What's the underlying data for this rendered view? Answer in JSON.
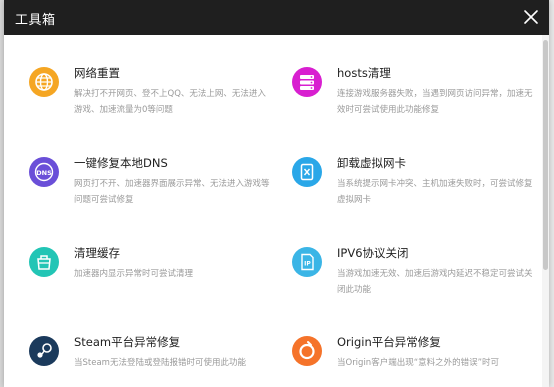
{
  "window": {
    "title": "工具箱"
  },
  "tools": [
    {
      "icon": "globe-icon",
      "color": "#f5a623",
      "name": "网络重置",
      "desc": "解决打不开网页、登不上QQ、无法上网、无法进入游戏、加速流量为0等问题"
    },
    {
      "icon": "server-icon",
      "color": "#d81fd0",
      "name": "hosts清理",
      "desc": "连接游戏服务器失败，当遇到网页访问异常，加速无效时可尝试使用此功能修复"
    },
    {
      "icon": "dns-icon",
      "color": "#6a4fd8",
      "name": "一键修复本地DNS",
      "desc": "网页打不开、加速器界面展示异常、无法进入游戏等问题可尝试修复"
    },
    {
      "icon": "network-card-icon",
      "color": "#2aa7e8",
      "name": "卸载虚拟网卡",
      "desc": "当系统提示网卡冲突、主机加速失败时，可尝试修复虚拟网卡"
    },
    {
      "icon": "clean-cache-icon",
      "color": "#22c5b5",
      "name": "清理缓存",
      "desc": "加速器内显示异常时可尝试清理"
    },
    {
      "icon": "ipv6-icon",
      "color": "#3bb5e6",
      "name": "IPV6协议关闭",
      "desc": "当游戏加速无效、加速后游戏内延迟不稳定可尝试关闭此功能"
    },
    {
      "icon": "steam-icon",
      "color": "#1b3a5c",
      "name": "Steam平台异常修复",
      "desc": "当Steam无法登陆或登陆报错时可使用此功能"
    },
    {
      "icon": "origin-icon",
      "color": "#f5732a",
      "name": "Origin平台异常修复",
      "desc": "当Origin客户端出现“意料之外的错误”时可"
    }
  ]
}
